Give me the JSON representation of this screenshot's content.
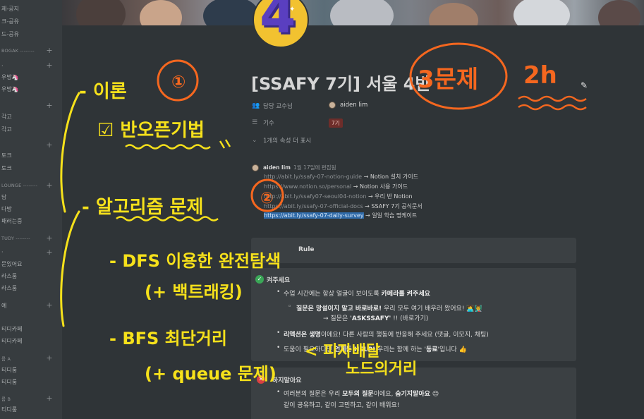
{
  "sidebar": {
    "rows": [
      {
        "label": "제-공지"
      },
      {
        "label": "크-공유"
      },
      {
        "label": "드-공유"
      },
      {
        "label": "BOGAK --------"
      },
      {
        "label": "·"
      },
      {
        "label": "우방🦄"
      },
      {
        "label": "우방🦄"
      },
      {
        "label": "각고"
      },
      {
        "label": "각고"
      },
      {
        "label": "토크"
      },
      {
        "label": "토크"
      },
      {
        "label": "LOUNGE --------"
      },
      {
        "label": "담"
      },
      {
        "label": "다방"
      },
      {
        "label": "패러는중"
      },
      {
        "label": "TUDY --------"
      },
      {
        "label": "·"
      },
      {
        "label": "문있어요"
      },
      {
        "label": "라스룸"
      },
      {
        "label": "라스룸"
      },
      {
        "label": "예"
      },
      {
        "label": "티디카페"
      },
      {
        "label": "티디카페"
      },
      {
        "label": "룹 A"
      },
      {
        "label": "티디룸"
      },
      {
        "label": "티디룸"
      },
      {
        "label": "룹 B"
      },
      {
        "label": "티디룸"
      }
    ]
  },
  "page": {
    "title": "[SSAFY 7기] 서울 4반",
    "properties": [
      {
        "icon": "people-icon",
        "label": "담당 교수님",
        "value": "aiden lim"
      },
      {
        "icon": "list-icon",
        "label": "기수",
        "value": "7기"
      }
    ],
    "more_props": "1개의 속성 더 표시"
  },
  "comment": {
    "author": "aiden lim",
    "date": "1월 17일에 편집됨",
    "links": [
      {
        "url": "http://abit.ly/ssafy-07-notion-guide",
        "desc": "→ Notion 설치 가이드"
      },
      {
        "url": "https://www.notion.so/personal",
        "desc": "→ Notion 사용 가이드"
      },
      {
        "url": "http://abit.ly/ssafy07-seoul04-notion",
        "desc": "→ 우리 반 Notion"
      },
      {
        "url": "https://abit.ly/ssafy-07-official-docs",
        "desc": "→ SSAFY 7기 공식문서"
      },
      {
        "url": "https://abit.ly/ssafy-07-daily-survey",
        "desc": "→ 일일 학습 명케이트"
      }
    ]
  },
  "callout1": {
    "title": "Rule"
  },
  "callout2": {
    "title": "켜주세요",
    "line1a": "수업 시간에는 항상 얼굴이 보이도록 ",
    "line1b": "카메라를 켜주세요",
    "sub1a": "질문은 망설이지 말고 바로바로!",
    "sub1b": " 우리 모두 여기 배우러 왔어요! 👩‍💻👨‍🏫",
    "sub2a": "→ 질문은 ",
    "sub2b": "'ASKSSAFY'",
    "sub2c": " !! (바로가기)",
    "line2a": "리액션은 생명",
    "line2b": "이에요! 다른 사람의 행동에 반응해 주세요 (댓글, 이모지, 채팅)",
    "line3a": "도움이 필요하다면 ",
    "line3b": "언제든 HELP!",
    "line3c": " 우리는 함께 하는 '",
    "line3d": "동료",
    "line3e": "'입니다 👍"
  },
  "callout3": {
    "title": "하지말아요",
    "line1a": "여러분의 질문은 우리 ",
    "line1b": "모두의 질문",
    "line1c": "이에요, ",
    "line1d": "숨기지말아요",
    "line1e": " 😊",
    "line2": "같이 공유하고, 같이 고민하고, 같이 배워요!"
  },
  "annotations": {
    "a1": "- 이론",
    "a2": "①",
    "a3": "☑ 반오픈기법",
    "a4": "- 알고리즘 문제",
    "a5": "②",
    "a6": "- DFS 이용한 완전탐색",
    "a7": "(+ 백트래킹)",
    "a8": "- BFS 최단거리",
    "a9": "(+ queue 문제)",
    "a10": "< 피자배달",
    "a11": "노드의거리",
    "a12": "3문제",
    "a13": "2h"
  },
  "colors": {
    "bg": "#2f3437",
    "sidebar": "#373c3f",
    "ink_yellow": "#f6e11b",
    "ink_orange": "#f5671f",
    "tag": "#6e2d2a",
    "link_highlight": "#2f6aa8"
  }
}
